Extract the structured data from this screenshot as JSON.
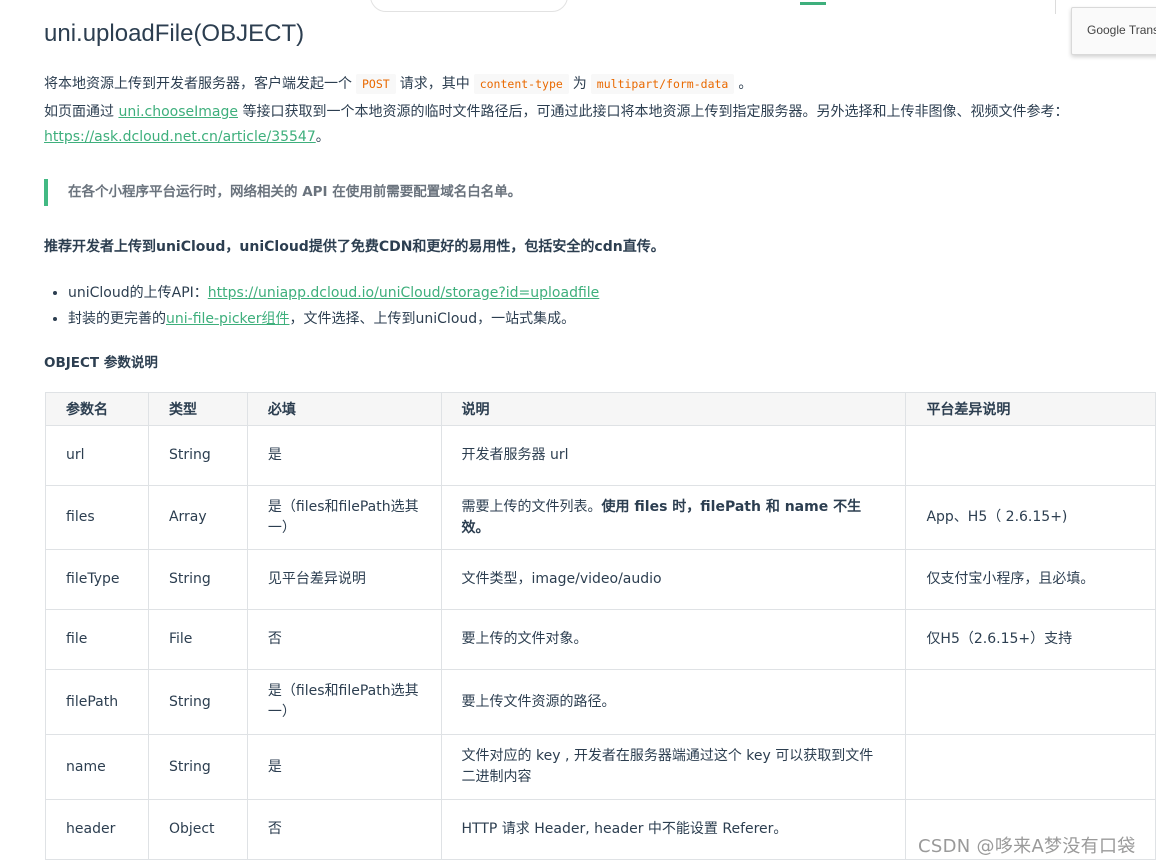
{
  "translate_widget": {
    "label": "Google Trans"
  },
  "doc": {
    "title": "uni.uploadFile(OBJECT)",
    "intro": {
      "p1_text1": "将本地资源上传到开发者服务器，客户端发起一个",
      "p1_code1": "POST",
      "p1_text2": "请求，其中",
      "p1_code2": "content-type",
      "p1_text3": "为",
      "p1_code3": "multipart/form-data",
      "p1_text4": "。",
      "p2_text1": "如页面通过",
      "p2_link": "uni.chooseImage",
      "p2_text2": "等接口获取到一个本地资源的临时文件路径后，可通过此接口将本地资源上传到指定服务器。另外选择和上传非图像、视频文件参考：",
      "p3_link": "https://ask.dcloud.net.cn/article/35547",
      "p3_text": "。"
    },
    "notice": "在各个小程序平台运行时，网络相关的 API 在使用前需要配置域名白名单。",
    "recommend": "推荐开发者上传到uniCloud，uniCloud提供了免费CDN和更好的易用性，包括安全的cdn直传。",
    "bullets": {
      "b1_text": "uniCloud的上传API：",
      "b1_link": "https://uniapp.dcloud.io/uniCloud/storage?id=uploadfile",
      "b2_text1": "封装的更完善的",
      "b2_link": "uni-file-picker组件",
      "b2_text2": "，文件选择、上传到uniCloud，一站式集成。"
    },
    "section_title": "OBJECT 参数说明",
    "table": {
      "headers": [
        "参数名",
        "类型",
        "必填",
        "说明",
        "平台差异说明"
      ],
      "rows": [
        [
          "url",
          "String",
          "是",
          "开发者服务器 url",
          ""
        ],
        [
          "files",
          "Array",
          "是（files和filePath选其一）",
          "",
          "App、H5（ 2.6.15+)"
        ],
        [
          "fileType",
          "String",
          "见平台差异说明",
          "文件类型，image/video/audio",
          "仅支付宝小程序，且必填。"
        ],
        [
          "file",
          "File",
          "否",
          "要上传的文件对象。",
          "仅H5（2.6.15+）支持"
        ],
        [
          "filePath",
          "String",
          "是（files和filePath选其一）",
          "要上传文件资源的路径。",
          ""
        ],
        [
          "name",
          "String",
          "是",
          "文件对应的 key , 开发者在服务器端通过这个 key 可以获取到文件二进制内容",
          ""
        ],
        [
          "header",
          "Object",
          "否",
          "HTTP 请求 Header, header 中不能设置 Referer。",
          ""
        ]
      ],
      "files_desc_plain": "需要上传的文件列表。",
      "files_desc_bold": "使用 files 时，filePath 和 name 不生效。"
    }
  },
  "watermark": "CSDN @哆来A梦没有口袋",
  "colors": {
    "accent": "#3eaf7c",
    "code": "#e96900",
    "quote_border": "#42b983"
  }
}
